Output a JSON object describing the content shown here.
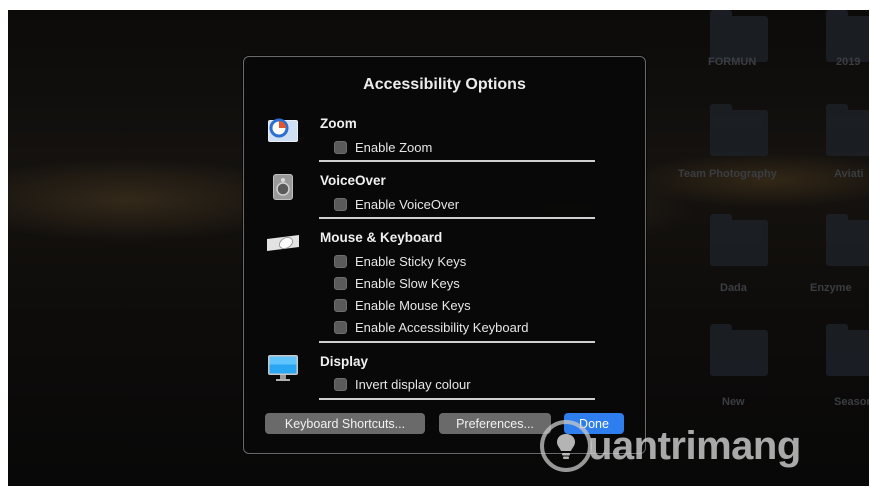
{
  "dialog": {
    "title": "Accessibility Options",
    "sections": [
      {
        "title": "Zoom",
        "icon": "zoom-icon",
        "options": [
          {
            "label": "Enable Zoom",
            "checked": false
          }
        ]
      },
      {
        "title": "VoiceOver",
        "icon": "voiceover-icon",
        "options": [
          {
            "label": "Enable VoiceOver",
            "checked": false
          }
        ]
      },
      {
        "title": "Mouse & Keyboard",
        "icon": "mouse-keyboard-icon",
        "options": [
          {
            "label": "Enable Sticky Keys",
            "checked": false
          },
          {
            "label": "Enable Slow Keys",
            "checked": false
          },
          {
            "label": "Enable Mouse Keys",
            "checked": false
          },
          {
            "label": "Enable Accessibility Keyboard",
            "checked": false
          }
        ]
      },
      {
        "title": "Display",
        "icon": "display-icon",
        "options": [
          {
            "label": "Invert display colour",
            "checked": false
          }
        ]
      }
    ],
    "buttons": {
      "keyboard_shortcuts": "Keyboard Shortcuts...",
      "preferences": "Preferences...",
      "done": "Done"
    }
  },
  "desktop": {
    "folders": [
      "FORMUN",
      "2019",
      "Team Photography",
      "Aviati",
      "Dada",
      "Enzyme",
      "New",
      "Season"
    ]
  },
  "watermark": {
    "text": "uantrimang"
  },
  "colors": {
    "accent": "#2f7ef0",
    "dialog_bg": "#080808",
    "button_bg": "#6a6a6a"
  }
}
